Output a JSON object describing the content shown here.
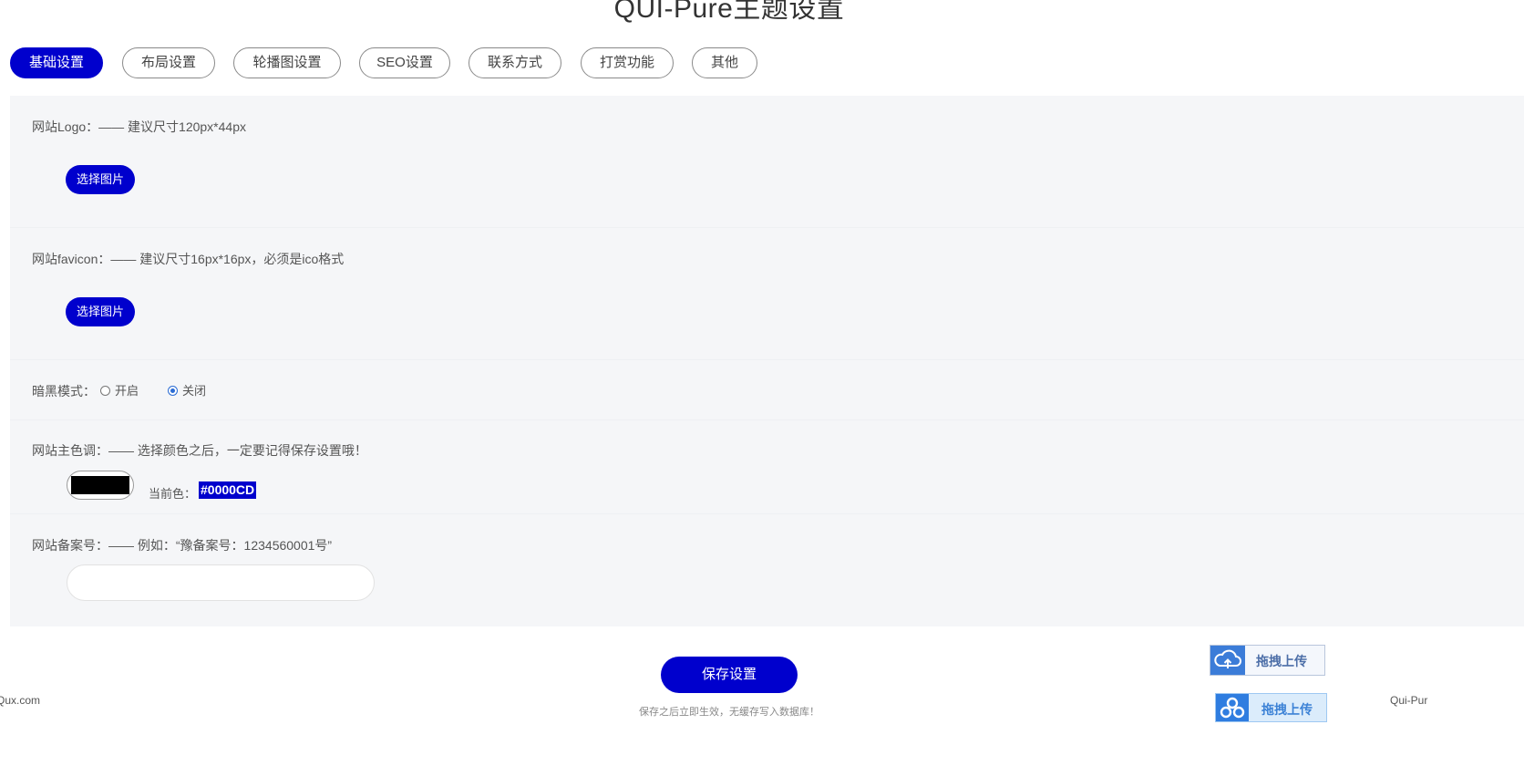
{
  "page": {
    "title": "QUI-Pure主题设置"
  },
  "tabs": [
    {
      "label": "基础设置",
      "active": true
    },
    {
      "label": "布局设置"
    },
    {
      "label": "轮播图设置"
    },
    {
      "label": "SEO设置"
    },
    {
      "label": "联系方式"
    },
    {
      "label": "打赏功能"
    },
    {
      "label": "其他"
    }
  ],
  "settings": {
    "logo": {
      "label": "网站Logo：—— 建议尺寸120px*44px",
      "button": "选择图片"
    },
    "favicon": {
      "label": "网站favicon：—— 建议尺寸16px*16px，必须是ico格式",
      "button": "选择图片"
    },
    "dark_mode": {
      "label": "暗黑模式：",
      "options": [
        {
          "label": "开启",
          "checked": false
        },
        {
          "label": "关闭",
          "checked": true
        }
      ]
    },
    "theme_color": {
      "label": "网站主色调：—— 选择颜色之后，一定要记得保存设置哦！",
      "current_label": "当前色：",
      "value": "#0000CD",
      "swatch_color": "#000000"
    },
    "icp": {
      "label": "网站备案号：—— 例如：“豫备案号：1234560001号”",
      "value": ""
    }
  },
  "actions": {
    "save_label": "保存设置",
    "save_note": "保存之后立即生效，无缓存写入数据库！"
  },
  "footer": {
    "left": "Qux.com",
    "right": "Qui-Pur"
  },
  "upload": {
    "label1": "拖拽上传",
    "label2": "拖拽上传"
  },
  "colors": {
    "accent": "#0000CD",
    "panel_bg": "#F5F6F8"
  }
}
